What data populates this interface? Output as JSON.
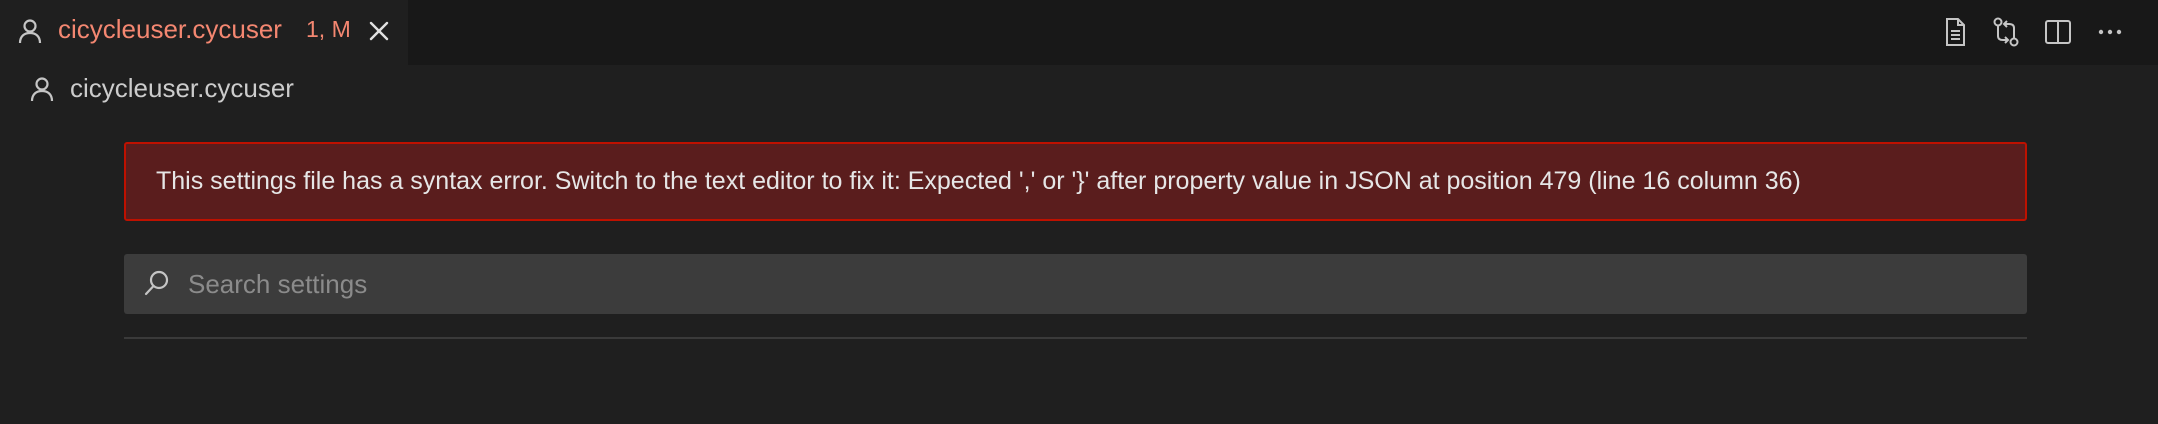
{
  "tab": {
    "title": "cicycleuser.cycuser",
    "badge": "1, M",
    "icon": "person-icon",
    "close_icon": "close-icon"
  },
  "editor_actions": [
    {
      "name": "open-settings-json",
      "icon": "file-icon"
    },
    {
      "name": "compare-changes",
      "icon": "git-compare-icon"
    },
    {
      "name": "split-editor",
      "icon": "split-editor-icon"
    },
    {
      "name": "more-actions",
      "icon": "ellipsis-icon"
    }
  ],
  "breadcrumb": {
    "label": "cicycleuser.cycuser",
    "icon": "person-icon"
  },
  "error": {
    "message": "This settings file has a syntax error. Switch to the text editor to fix it: Expected ',' or '}' after property value in JSON at position 479 (line 16 column 36)"
  },
  "search": {
    "placeholder": "Search settings",
    "value": ""
  },
  "colors": {
    "background": "#1f1f1f",
    "tabbar": "#181818",
    "tab_title_modified": "#f48771",
    "error_background": "#5a1d1d",
    "error_border": "#be1100",
    "search_background": "#3c3c3c"
  }
}
